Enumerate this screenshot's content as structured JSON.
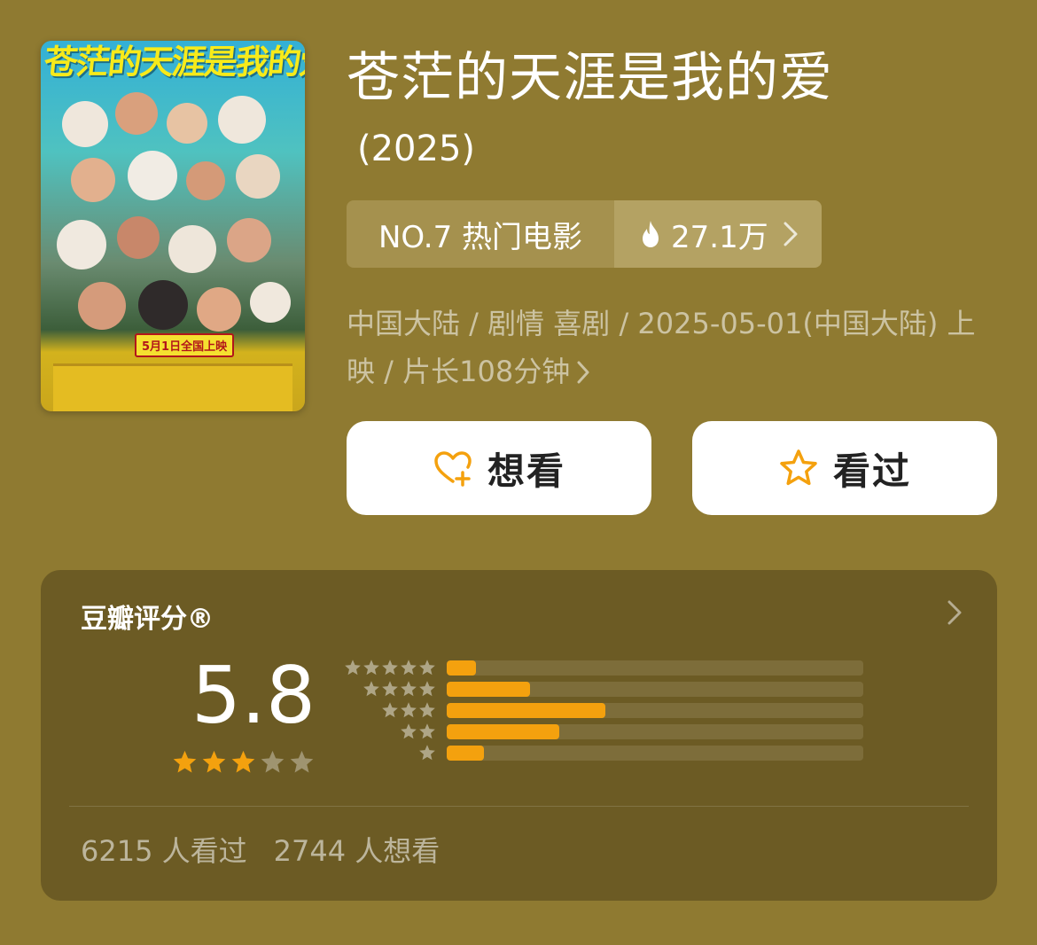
{
  "poster": {
    "title_art": "苍茫的天涯是我的爱",
    "release_banner": "5月1日全国上映"
  },
  "movie": {
    "title": "苍茫的天涯是我的爱",
    "year": "(2025)"
  },
  "rank": {
    "label": "NO.7 热门电影",
    "heat": "27.1万"
  },
  "meta": {
    "info": "中国大陆 / 剧情 喜剧 / 2025-05-01(中国大陆) 上映 / 片长108分钟"
  },
  "actions": {
    "want_label": "想看",
    "seen_label": "看过"
  },
  "rating": {
    "title": "豆瓣评分®",
    "score": "5.8",
    "stars_filled": 3,
    "stars_total": 5,
    "distribution": [
      {
        "stars": 5,
        "fraction": 0.07
      },
      {
        "stars": 4,
        "fraction": 0.2
      },
      {
        "stars": 3,
        "fraction": 0.38
      },
      {
        "stars": 2,
        "fraction": 0.27
      },
      {
        "stars": 1,
        "fraction": 0.09
      }
    ],
    "seen_count": "6215 人看过",
    "want_count": "2744 人想看"
  },
  "colors": {
    "background": "#8f7a31",
    "accent": "#f4a10e",
    "card": "#6c5b24"
  }
}
